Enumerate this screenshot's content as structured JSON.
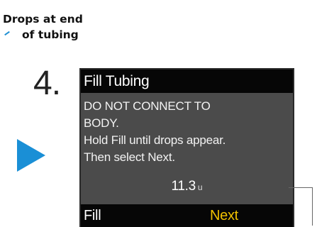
{
  "annotation": {
    "line1": "Drops at end",
    "line2": "of tubing",
    "accent_color": "#1e8fd3"
  },
  "step": {
    "number": "4."
  },
  "pointer": {
    "icon": "play-arrow-icon",
    "color": "#1a8fd6"
  },
  "screen": {
    "title": "Fill Tubing",
    "lines": [
      "DO NOT CONNECT TO",
      "BODY.",
      "Hold Fill until drops appear.",
      "Then select Next."
    ],
    "volume": {
      "value": "11.3",
      "unit": "u"
    },
    "softkeys": {
      "left": "Fill",
      "right": "Next"
    },
    "colors": {
      "background": "#4b4b4b",
      "title_bar": "#060606",
      "selected_softkey": "#f0c000"
    }
  }
}
